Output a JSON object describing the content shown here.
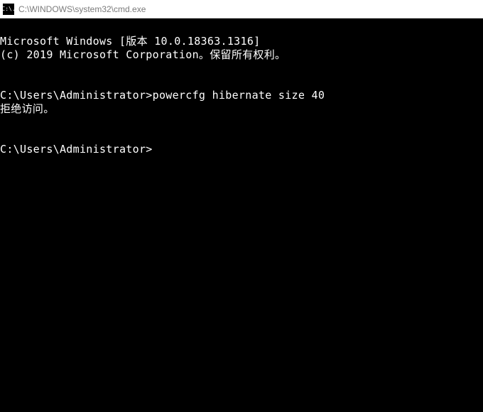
{
  "titlebar": {
    "icon_text": "C:\\.",
    "title": "C:\\WINDOWS\\system32\\cmd.exe"
  },
  "terminal": {
    "line1": "Microsoft Windows [版本 10.0.18363.1316]",
    "line2": "(c) 2019 Microsoft Corporation。保留所有权利。",
    "prompt1": "C:\\Users\\Administrator>",
    "command1": "powercfg hibernate size 40",
    "output1": "拒绝访问。",
    "prompt2": "C:\\Users\\Administrator>"
  }
}
